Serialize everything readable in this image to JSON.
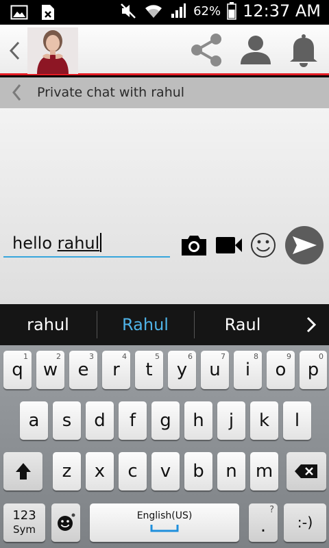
{
  "status_bar": {
    "battery_percent": "62%",
    "time": "12:37 AM"
  },
  "app_bar": {
    "icons": [
      "back-icon",
      "share-icon",
      "profile-icon",
      "bell-icon"
    ],
    "accent_color": "#e41b23"
  },
  "chat_header": {
    "title": "Private chat with rahul"
  },
  "composer": {
    "text_prefix": "hello ",
    "text_underlined": "rahul",
    "underline_color": "#36a5dc",
    "icons": [
      "camera-icon",
      "video-icon",
      "smiley-icon",
      "send-icon"
    ]
  },
  "suggestions": {
    "items": [
      "rahul",
      "Rahul",
      "Raul"
    ],
    "highlight_color": "#4fb3e8"
  },
  "keyboard": {
    "row1": [
      "q",
      "w",
      "e",
      "r",
      "t",
      "y",
      "u",
      "i",
      "o",
      "p"
    ],
    "row1_hints": [
      "1",
      "2",
      "3",
      "4",
      "5",
      "6",
      "7",
      "8",
      "9",
      "0"
    ],
    "row2": [
      "a",
      "s",
      "d",
      "f",
      "g",
      "h",
      "j",
      "k",
      "l"
    ],
    "row3": [
      "z",
      "x",
      "c",
      "v",
      "b",
      "n",
      "m"
    ],
    "sym_key": "123",
    "sym_key_sub": "Sym",
    "space_label": "English(US)",
    "period_key": ".",
    "period_hint": "?",
    "emoticon_key": ":-)"
  }
}
